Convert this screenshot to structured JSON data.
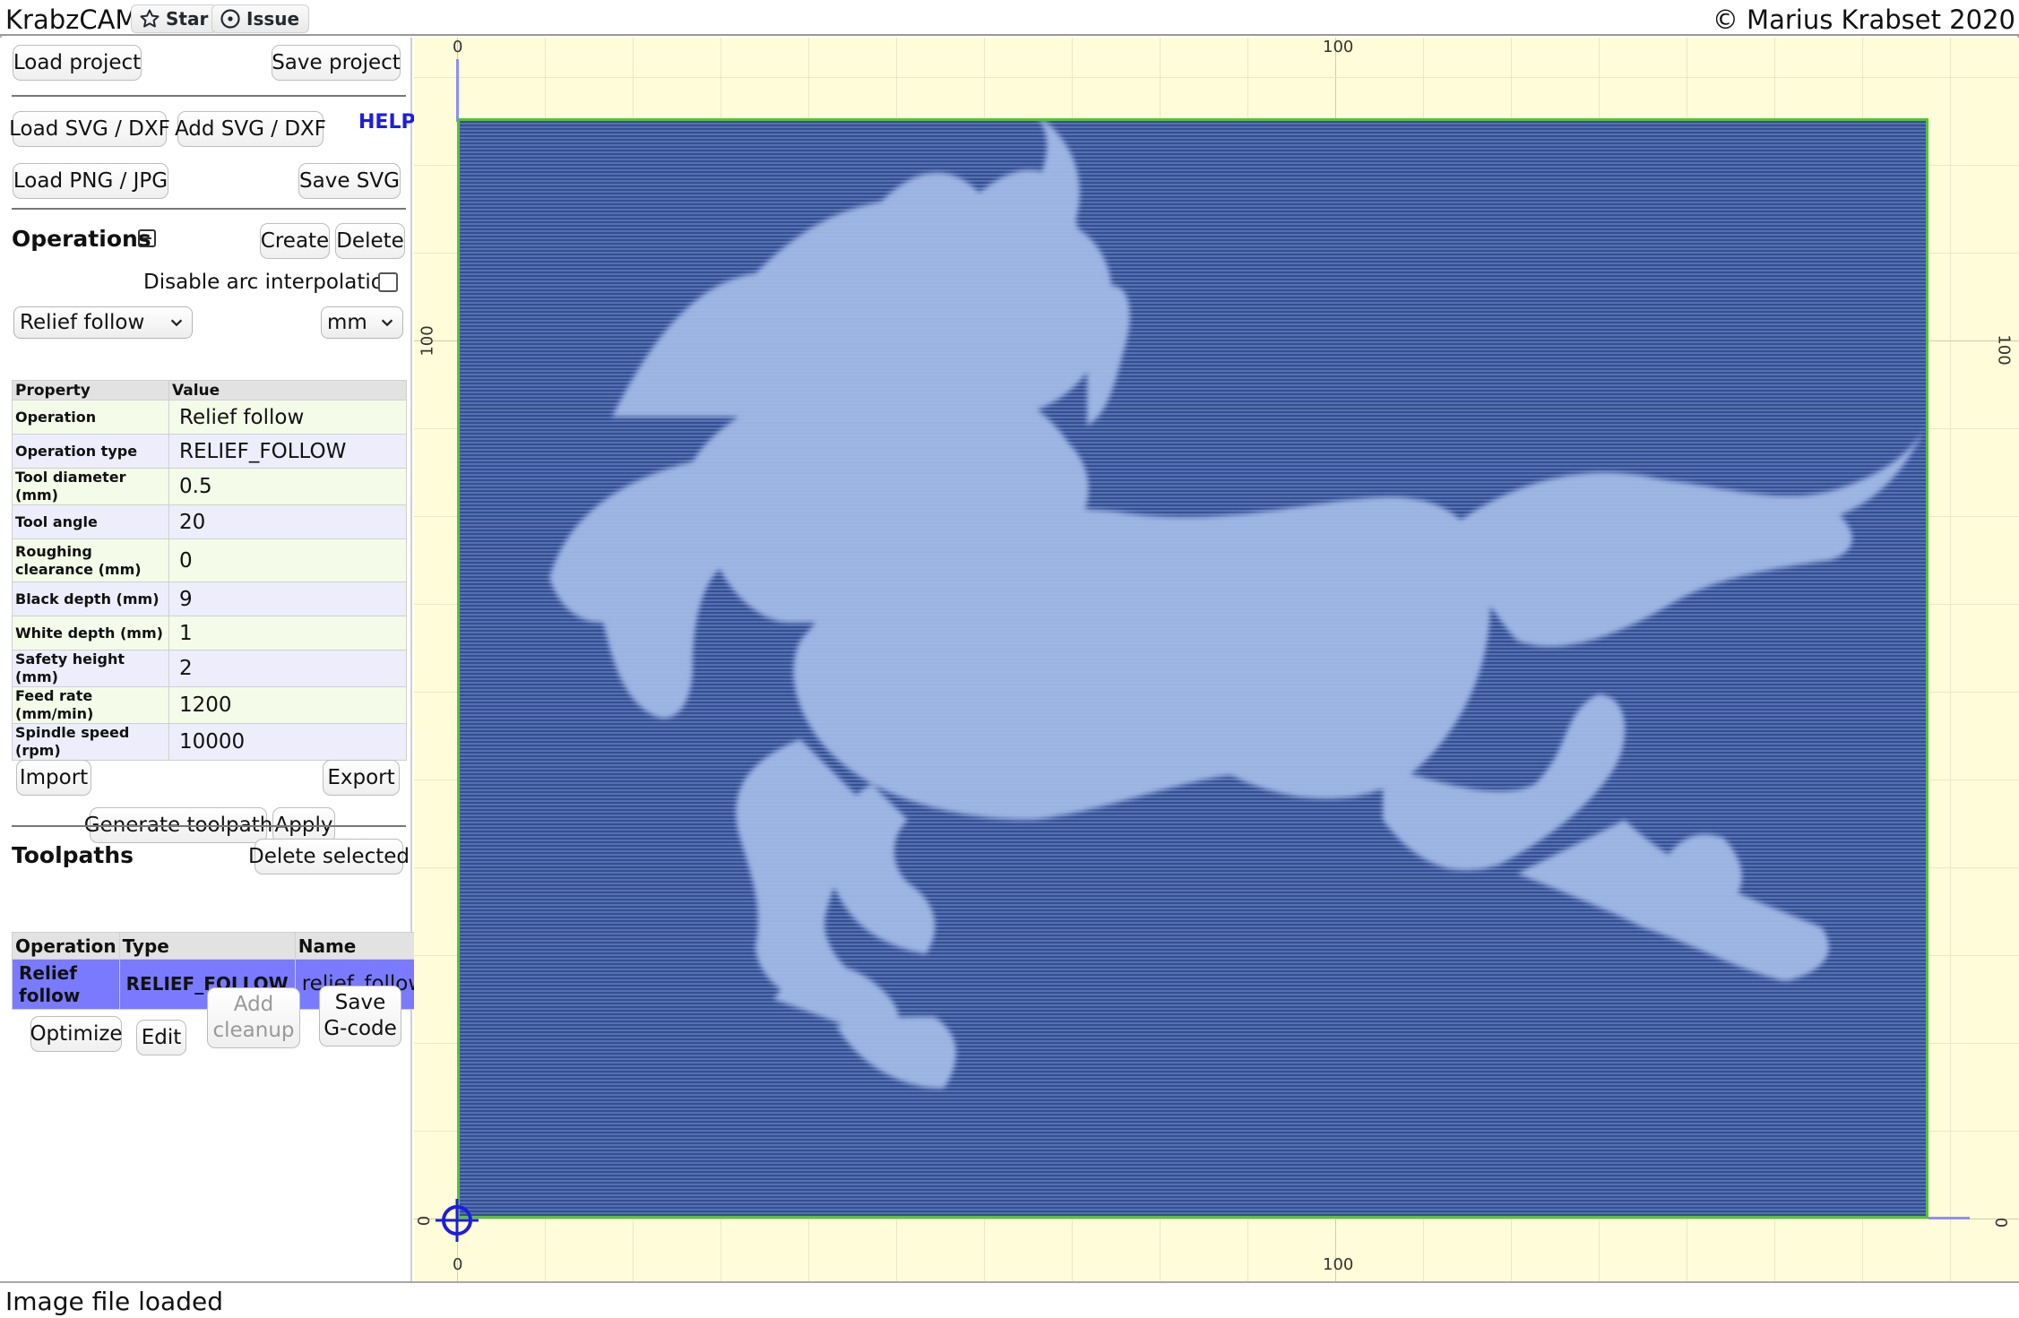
{
  "header": {
    "app_title": "KrabzCAM",
    "star_label": "Star",
    "issue_label": "Issue",
    "copyright": "© Marius Krabset 2020"
  },
  "sidebar": {
    "load_project": "Load project",
    "save_project": "Save project",
    "load_svg": "Load SVG / DXF",
    "add_svg": "Add SVG / DXF",
    "help": "HELP",
    "load_png": "Load PNG / JPG",
    "save_svg": "Save SVG",
    "operations_title": "Operations",
    "create": "Create",
    "delete": "Delete",
    "disable_arc_label": "Disable arc interpolation",
    "disable_arc_checked": false,
    "operation_select": "Relief follow",
    "unit_select": "mm",
    "props_header": {
      "property": "Property",
      "value": "Value"
    },
    "props": [
      {
        "key": "Operation",
        "value": "Relief follow"
      },
      {
        "key": "Operation type",
        "value": "RELIEF_FOLLOW"
      },
      {
        "key": "Tool diameter (mm)",
        "value": "0.5"
      },
      {
        "key": "Tool angle",
        "value": "20"
      },
      {
        "key": "Roughing clearance (mm)",
        "value": "0"
      },
      {
        "key": "Black depth (mm)",
        "value": "9"
      },
      {
        "key": "White depth (mm)",
        "value": "1"
      },
      {
        "key": "Safety height (mm)",
        "value": "2"
      },
      {
        "key": "Feed rate (mm/min)",
        "value": "1200"
      },
      {
        "key": "Spindle speed (rpm)",
        "value": "10000"
      }
    ],
    "import": "Import",
    "export": "Export",
    "generate_toolpath": "Generate toolpath",
    "apply": "Apply",
    "toolpaths_title": "Toolpaths",
    "delete_selected": "Delete selected",
    "toolpath_headers": {
      "operation": "Operation",
      "type": "Type",
      "name": "Name"
    },
    "toolpath_rows": [
      {
        "operation": "Relief follow",
        "type": "RELIEF_FOLLOW",
        "name": "relief_follow"
      }
    ],
    "optimize": "Optimize",
    "edit": "Edit",
    "add_cleanup_1": "Add",
    "add_cleanup_2": "cleanup",
    "save_gcode_1": "Save",
    "save_gcode_2": "G-code"
  },
  "canvas": {
    "ticks": {
      "top_zero": "0",
      "top_hundred": "100",
      "bottom_zero": "0",
      "bottom_hundred": "100",
      "left_hundred": "100",
      "left_zero": "0",
      "right_hundred": "100",
      "right_zero": "0"
    },
    "stock_border_color": "#58c03f",
    "stock_color": "#34508f",
    "relief_color": "#a9c2ef",
    "background_color": "#fffdd9"
  },
  "status": {
    "message": "Image file loaded"
  }
}
